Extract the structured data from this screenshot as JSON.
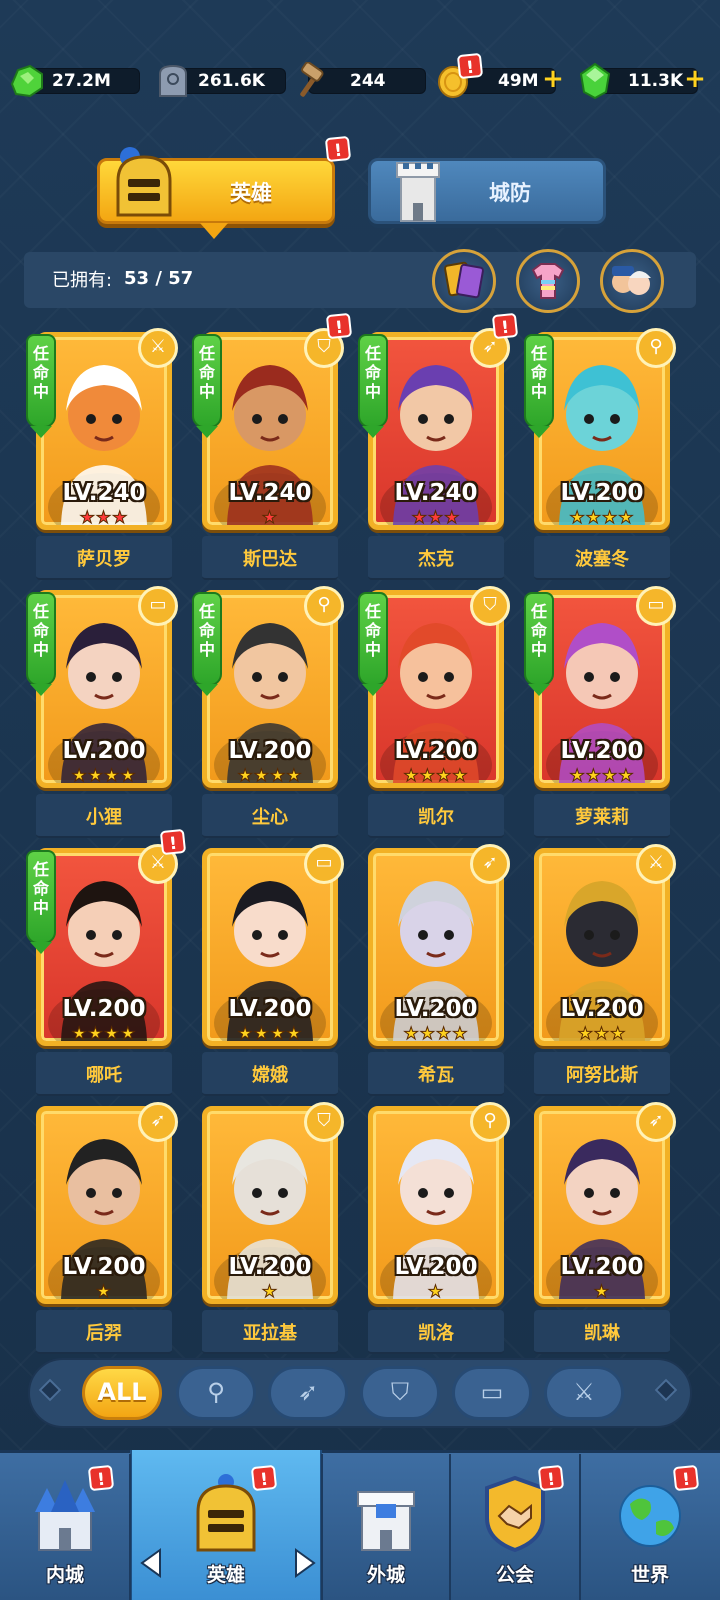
{
  "resources": [
    {
      "name": "green-ore",
      "value": "27.2M",
      "icon": "green-ore-icon",
      "has_plus": false
    },
    {
      "name": "stone",
      "value": "261.6K",
      "icon": "stone-tablet-icon",
      "has_plus": false
    },
    {
      "name": "hammer",
      "value": "244",
      "icon": "hammer-icon",
      "has_plus": false
    },
    {
      "name": "gold",
      "value": "49M",
      "icon": "gold-coin-icon",
      "has_plus": true
    },
    {
      "name": "gem",
      "value": "11.3K",
      "icon": "green-gem-icon",
      "has_plus": true
    }
  ],
  "tabs": {
    "hero": "英雄",
    "defense": "城防"
  },
  "owned": {
    "label": "已拥有:",
    "count": "53 / 57"
  },
  "appoint_label": "任命中",
  "heroes": [
    {
      "name": "萨贝罗",
      "level": "LV.240",
      "stars": 3,
      "star_color": "red",
      "frame": "gold",
      "role": "sword",
      "appointed": true,
      "alert": false
    },
    {
      "name": "斯巴达",
      "level": "LV.240",
      "stars": 1,
      "star_color": "red",
      "frame": "gold",
      "role": "shield",
      "appointed": true,
      "alert": true
    },
    {
      "name": "杰克",
      "level": "LV.240",
      "stars": 3,
      "star_color": "red",
      "frame": "red",
      "role": "bow",
      "appointed": true,
      "alert": true
    },
    {
      "name": "波塞冬",
      "level": "LV.200",
      "stars": 4,
      "star_color": "gold",
      "frame": "gold",
      "role": "staff",
      "appointed": true,
      "alert": false
    },
    {
      "name": "小狸",
      "level": "LV.200",
      "stars": 4,
      "star_color": "gold",
      "frame": "gold",
      "role": "book",
      "appointed": true,
      "alert": false
    },
    {
      "name": "尘心",
      "level": "LV.200",
      "stars": 4,
      "star_color": "gold",
      "frame": "gold",
      "role": "staff",
      "appointed": true,
      "alert": false
    },
    {
      "name": "凯尔",
      "level": "LV.200",
      "stars": 4,
      "star_color": "gold",
      "frame": "red",
      "role": "shield",
      "appointed": true,
      "alert": false
    },
    {
      "name": "萝莱莉",
      "level": "LV.200",
      "stars": 4,
      "star_color": "gold",
      "frame": "red",
      "role": "book",
      "appointed": true,
      "alert": false
    },
    {
      "name": "哪吒",
      "level": "LV.200",
      "stars": 4,
      "star_color": "gold",
      "frame": "red",
      "role": "sword",
      "appointed": true,
      "alert": true
    },
    {
      "name": "嫦娥",
      "level": "LV.200",
      "stars": 4,
      "star_color": "gold",
      "frame": "gold",
      "role": "book",
      "appointed": false,
      "alert": false
    },
    {
      "name": "希瓦",
      "level": "LV.200",
      "stars": 4,
      "star_color": "gold",
      "frame": "gold",
      "role": "bow",
      "appointed": false,
      "alert": false
    },
    {
      "name": "阿努比斯",
      "level": "LV.200",
      "stars": 3,
      "star_color": "gold",
      "frame": "gold",
      "role": "sword",
      "appointed": false,
      "alert": false
    },
    {
      "name": "后羿",
      "level": "LV.200",
      "stars": 1,
      "star_color": "gold",
      "frame": "gold",
      "role": "bow",
      "appointed": false,
      "alert": false
    },
    {
      "name": "亚拉基",
      "level": "LV.200",
      "stars": 1,
      "star_color": "gold",
      "frame": "gold",
      "role": "shield",
      "appointed": false,
      "alert": false
    },
    {
      "name": "凯洛",
      "level": "LV.200",
      "stars": 1,
      "star_color": "gold",
      "frame": "gold",
      "role": "staff",
      "appointed": false,
      "alert": false
    },
    {
      "name": "凯琳",
      "level": "LV.200",
      "stars": 1,
      "star_color": "gold",
      "frame": "gold",
      "role": "bow",
      "appointed": false,
      "alert": false
    }
  ],
  "filters": [
    "ALL",
    "staff",
    "bow",
    "shield",
    "book",
    "sword"
  ],
  "filter_icons": [
    "",
    "⚲",
    "➶",
    "⛉",
    "▭",
    "⚔"
  ],
  "active_filter": "ALL",
  "nav": [
    {
      "label": "内城",
      "icon": "inner-castle-icon",
      "alert": true
    },
    {
      "label": "英雄",
      "icon": "hero-helmet-icon",
      "alert": true
    },
    {
      "label": "外城",
      "icon": "outer-castle-icon",
      "alert": false
    },
    {
      "label": "公会",
      "icon": "guild-handshake-icon",
      "alert": true
    },
    {
      "label": "世界",
      "icon": "world-globe-icon",
      "alert": true
    }
  ],
  "colors": {
    "accent_gold": "#f3a612",
    "alert_red": "#e8322b",
    "appoint_green": "#2ea62a",
    "name_gold": "#ffc93c",
    "bg": "#1b3550"
  }
}
